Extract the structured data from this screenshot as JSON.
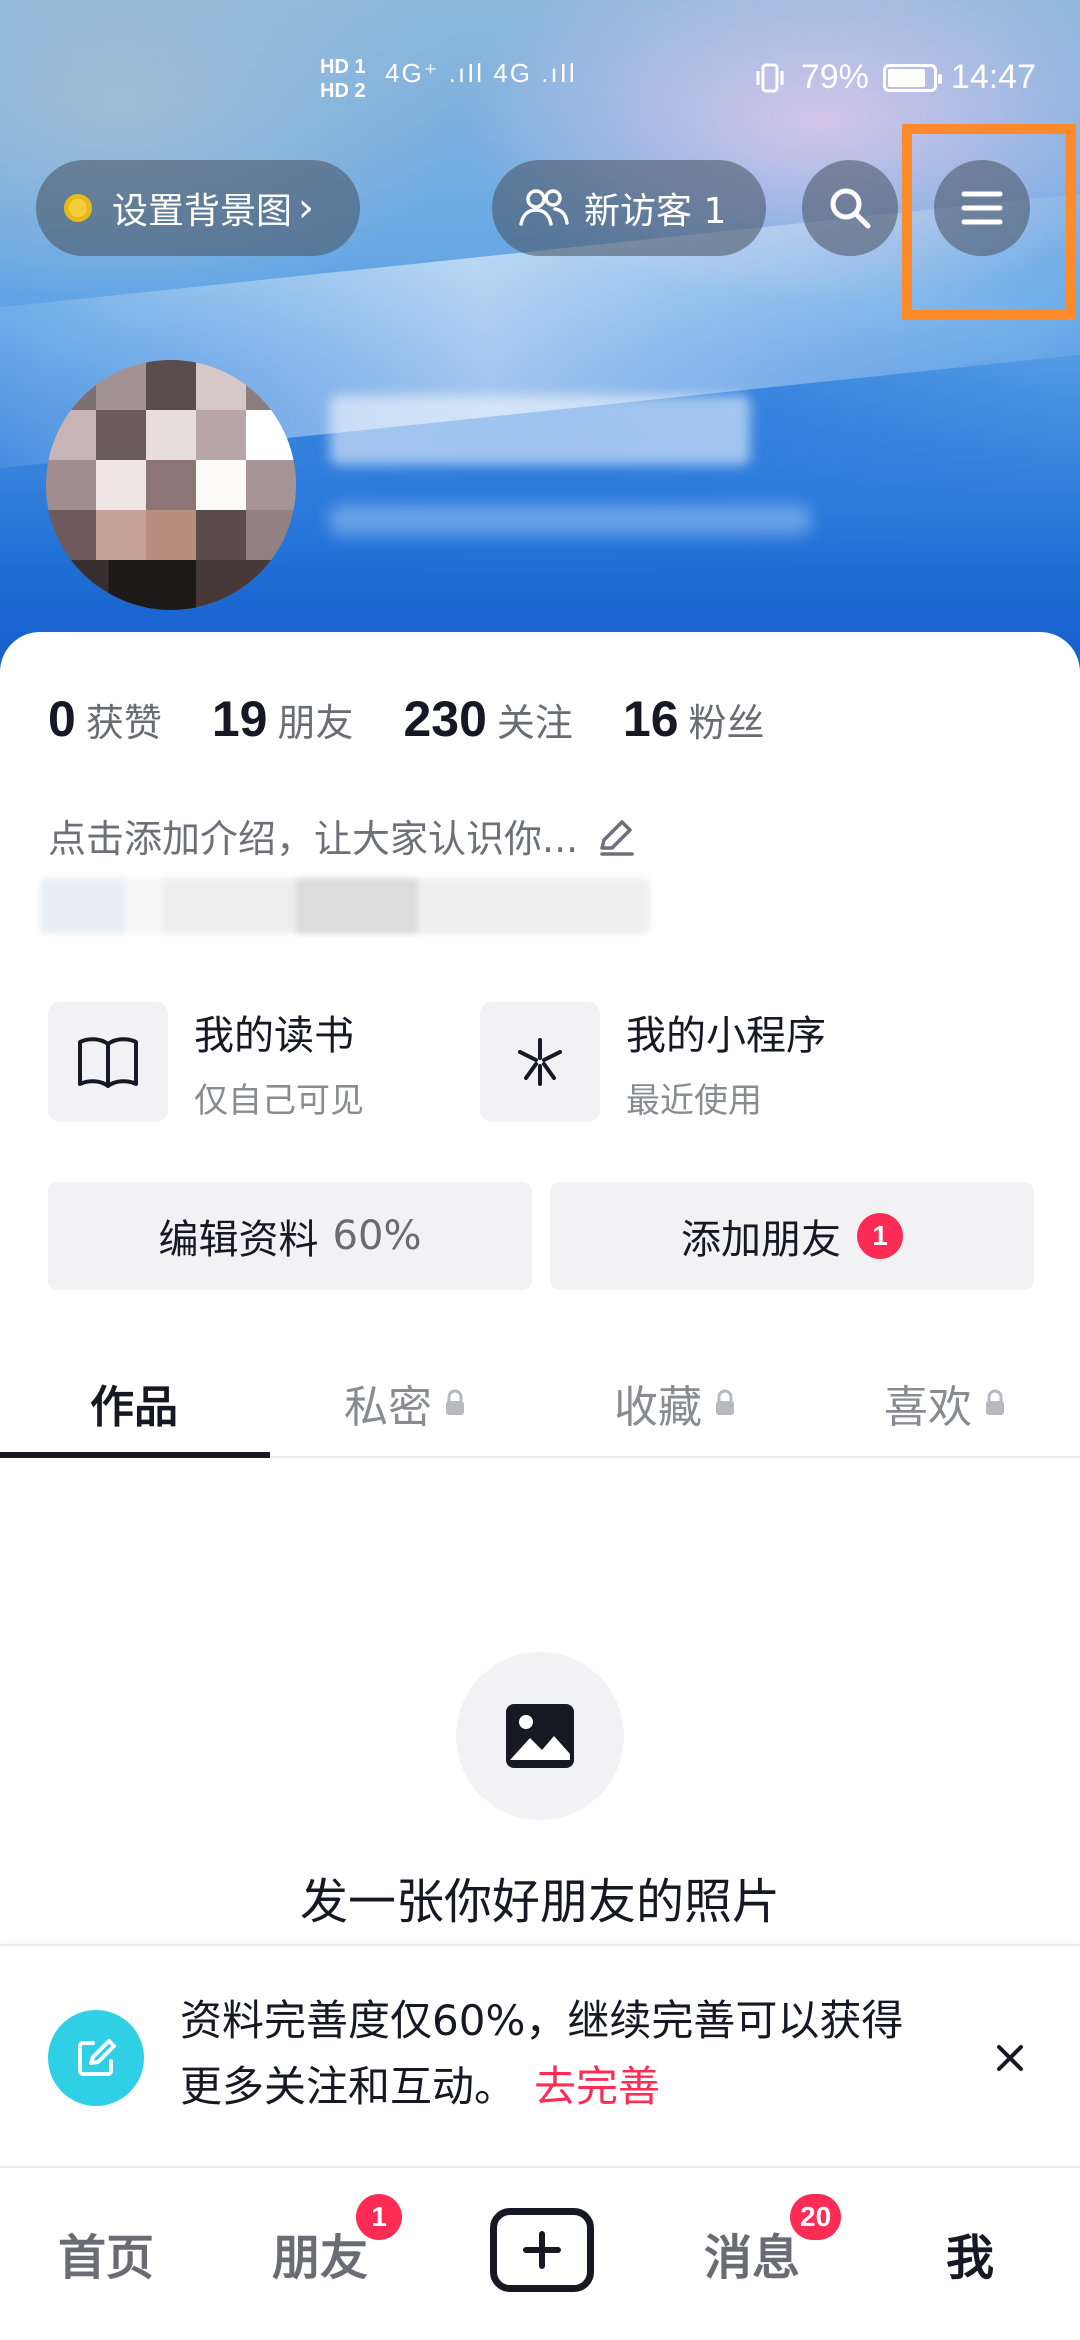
{
  "status_bar": {
    "net": "HD 1\nHD 2",
    "signal": "4G⁺ .ıIl 4G .ıIl",
    "battery_pct": "79%",
    "time": "14:47"
  },
  "header": {
    "set_bg_label": "设置背景图",
    "set_bg_chevron": "›",
    "visitors_label": "新访客 1",
    "search_icon": "search-icon",
    "menu_icon": "menu-icon",
    "highlight_color": "#ff8a2a"
  },
  "profile": {
    "stats": [
      {
        "num": "0",
        "label": "获赞"
      },
      {
        "num": "19",
        "label": "朋友"
      },
      {
        "num": "230",
        "label": "关注"
      },
      {
        "num": "16",
        "label": "粉丝"
      }
    ],
    "bio_placeholder": "点击添加介绍，让大家认识你..."
  },
  "shortcuts": [
    {
      "title": "我的读书",
      "subtitle": "仅自己可见",
      "icon": "book-icon"
    },
    {
      "title": "我的小程序",
      "subtitle": "最近使用",
      "icon": "mini-program-icon"
    }
  ],
  "actions": {
    "edit_profile": "编辑资料",
    "edit_profile_pct": "60%",
    "add_friends": "添加朋友",
    "add_friends_badge": "1"
  },
  "tabs": [
    {
      "label": "作品",
      "locked": false
    },
    {
      "label": "私密",
      "locked": true
    },
    {
      "label": "收藏",
      "locked": true
    },
    {
      "label": "喜欢",
      "locked": true
    }
  ],
  "empty_state": {
    "icon": "image-icon",
    "text": "发一张你好朋友的照片"
  },
  "notice": {
    "text": "资料完善度仅60%，继续完善可以获得更多关注和互动。",
    "link": "去完善",
    "accent": "#fe2c55",
    "icon_color": "#2fd0e6"
  },
  "bottom_nav": {
    "home": "首页",
    "friends": "朋友",
    "friends_badge": "1",
    "messages": "消息",
    "messages_badge": "20",
    "me": "我"
  }
}
